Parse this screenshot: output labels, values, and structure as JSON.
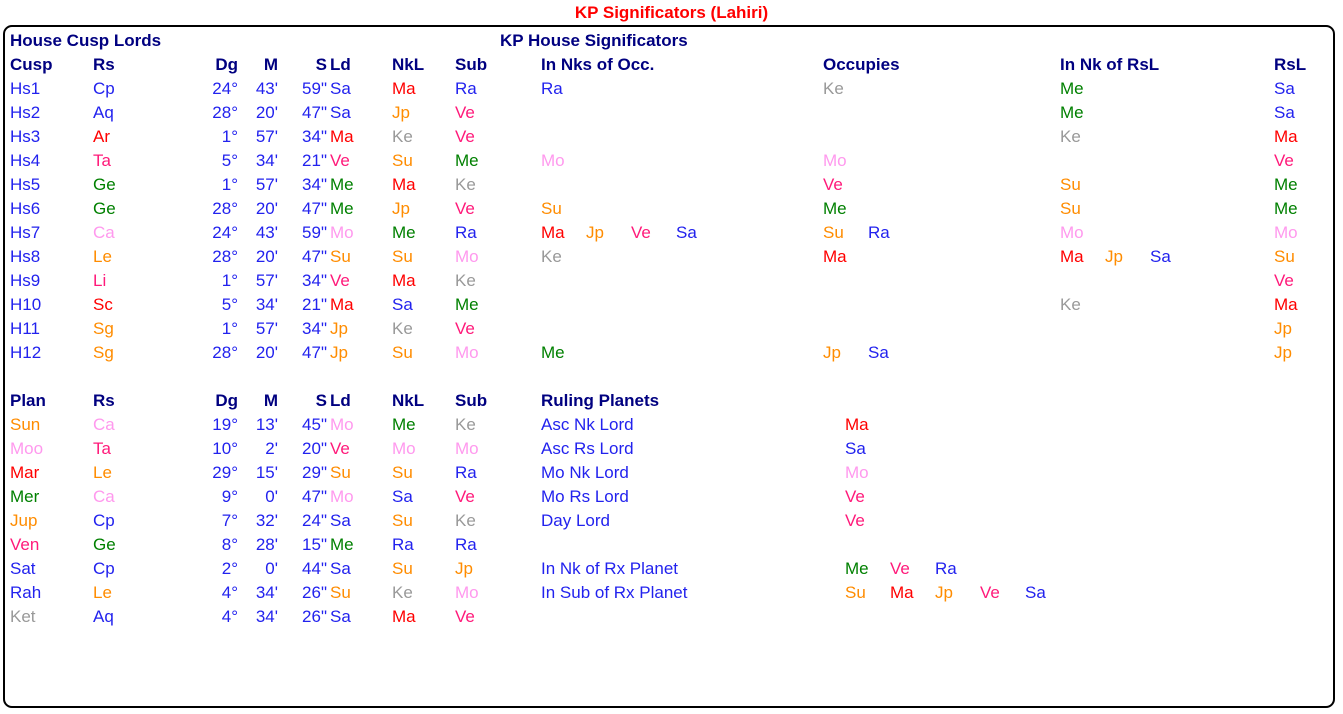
{
  "title": "KP Significators (Lahiri)",
  "sections": {
    "house_cusp_lords": "House Cusp Lords",
    "kp_house_significators": "KP House Significators",
    "ruling_planets": "Ruling Planets"
  },
  "cusp_headers": [
    "Cusp",
    "Rs",
    "Dg",
    "M",
    "S",
    "Ld",
    "NkL",
    "Sub"
  ],
  "sig_headers": [
    "In Nks of Occ.",
    "Occupies",
    "In Nk of RsL",
    "RsL"
  ],
  "plan_headers": [
    "Plan",
    "Rs",
    "Dg",
    "M",
    "S",
    "Ld",
    "NkL",
    "Sub"
  ],
  "colors": {
    "title": "#FF0000",
    "heading": "#000080",
    "number": "#2222EE",
    "Su": "#FF8C00",
    "Mo": "#FF99EE",
    "Ma": "#FF0000",
    "Me": "#008000",
    "Jp": "#FF8C00",
    "Ve": "#FF1A7A",
    "Sa": "#2222EE",
    "Ra": "#2222EE",
    "Ke": "#999999"
  },
  "cusp_rows": [
    {
      "cusp": "Hs1",
      "rs": "Cp",
      "rs_c": "sa",
      "dg": "24°",
      "m": "43'",
      "s": "59\"",
      "ld": "Sa",
      "ld_c": "sa",
      "nkl": "Ma",
      "nkl_c": "ma",
      "sub": "Ra",
      "sub_c": "ra",
      "nks_occ": [],
      "occupies": [
        {
          "t": "Ke",
          "c": "ke"
        }
      ],
      "nk_rsl": [
        {
          "t": "Me",
          "c": "me"
        }
      ],
      "rsl": "Sa",
      "rsl_c": "sa",
      "nks_occ_list": [
        {
          "t": "Ra",
          "c": "ra"
        }
      ]
    },
    {
      "cusp": "Hs2",
      "rs": "Aq",
      "rs_c": "sa",
      "dg": "28°",
      "m": "20'",
      "s": "47\"",
      "ld": "Sa",
      "ld_c": "sa",
      "nkl": "Jp",
      "nkl_c": "jp",
      "sub": "Ve",
      "sub_c": "ve",
      "nks_occ_list": [],
      "occupies": [],
      "nk_rsl": [
        {
          "t": "Me",
          "c": "me"
        }
      ],
      "rsl": "Sa",
      "rsl_c": "sa"
    },
    {
      "cusp": "Hs3",
      "rs": "Ar",
      "rs_c": "ma",
      "dg": "1°",
      "m": "57'",
      "s": "34\"",
      "ld": "Ma",
      "ld_c": "ma",
      "nkl": "Ke",
      "nkl_c": "ke",
      "sub": "Ve",
      "sub_c": "ve",
      "nks_occ_list": [],
      "occupies": [],
      "nk_rsl": [
        {
          "t": "Ke",
          "c": "ke"
        }
      ],
      "rsl": "Ma",
      "rsl_c": "ma"
    },
    {
      "cusp": "Hs4",
      "rs": "Ta",
      "rs_c": "ve",
      "dg": "5°",
      "m": "34'",
      "s": "21\"",
      "ld": "Ve",
      "ld_c": "ve",
      "nkl": "Su",
      "nkl_c": "su",
      "sub": "Me",
      "sub_c": "me",
      "nks_occ_list": [
        {
          "t": "Mo",
          "c": "mo"
        }
      ],
      "occupies": [
        {
          "t": "Mo",
          "c": "mo"
        }
      ],
      "nk_rsl": [],
      "rsl": "Ve",
      "rsl_c": "ve"
    },
    {
      "cusp": "Hs5",
      "rs": "Ge",
      "rs_c": "me",
      "dg": "1°",
      "m": "57'",
      "s": "34\"",
      "ld": "Me",
      "ld_c": "me",
      "nkl": "Ma",
      "nkl_c": "ma",
      "sub": "Ke",
      "sub_c": "ke",
      "nks_occ_list": [],
      "occupies": [
        {
          "t": "Ve",
          "c": "ve"
        }
      ],
      "nk_rsl": [
        {
          "t": "Su",
          "c": "su"
        }
      ],
      "rsl": "Me",
      "rsl_c": "me"
    },
    {
      "cusp": "Hs6",
      "rs": "Ge",
      "rs_c": "me",
      "dg": "28°",
      "m": "20'",
      "s": "47\"",
      "ld": "Me",
      "ld_c": "me",
      "nkl": "Jp",
      "nkl_c": "jp",
      "sub": "Ve",
      "sub_c": "ve",
      "nks_occ_list": [
        {
          "t": "Su",
          "c": "su"
        }
      ],
      "occupies": [
        {
          "t": "Me",
          "c": "me"
        }
      ],
      "nk_rsl": [
        {
          "t": "Su",
          "c": "su"
        }
      ],
      "rsl": "Me",
      "rsl_c": "me"
    },
    {
      "cusp": "Hs7",
      "rs": "Ca",
      "rs_c": "mo",
      "dg": "24°",
      "m": "43'",
      "s": "59\"",
      "ld": "Mo",
      "ld_c": "mo",
      "nkl": "Me",
      "nkl_c": "me",
      "sub": "Ra",
      "sub_c": "ra",
      "nks_occ_list": [
        {
          "t": "Ma",
          "c": "ma"
        },
        {
          "t": "Jp",
          "c": "jp"
        },
        {
          "t": "Ve",
          "c": "ve"
        },
        {
          "t": "Sa",
          "c": "sa"
        }
      ],
      "occupies": [
        {
          "t": "Su",
          "c": "su"
        },
        {
          "t": "Ra",
          "c": "ra"
        }
      ],
      "nk_rsl": [
        {
          "t": "Mo",
          "c": "mo"
        }
      ],
      "rsl": "Mo",
      "rsl_c": "mo"
    },
    {
      "cusp": "Hs8",
      "rs": "Le",
      "rs_c": "su",
      "dg": "28°",
      "m": "20'",
      "s": "47\"",
      "ld": "Su",
      "ld_c": "su",
      "nkl": "Su",
      "nkl_c": "su",
      "sub": "Mo",
      "sub_c": "mo",
      "nks_occ_list": [
        {
          "t": "Ke",
          "c": "ke"
        }
      ],
      "occupies": [
        {
          "t": "Ma",
          "c": "ma"
        }
      ],
      "nk_rsl": [
        {
          "t": "Ma",
          "c": "ma"
        },
        {
          "t": "Jp",
          "c": "jp"
        },
        {
          "t": "Sa",
          "c": "sa"
        }
      ],
      "rsl": "Su",
      "rsl_c": "su"
    },
    {
      "cusp": "Hs9",
      "rs": "Li",
      "rs_c": "ve",
      "dg": "1°",
      "m": "57'",
      "s": "34\"",
      "ld": "Ve",
      "ld_c": "ve",
      "nkl": "Ma",
      "nkl_c": "ma",
      "sub": "Ke",
      "sub_c": "ke",
      "nks_occ_list": [],
      "occupies": [],
      "nk_rsl": [],
      "rsl": "Ve",
      "rsl_c": "ve"
    },
    {
      "cusp": "H10",
      "rs": "Sc",
      "rs_c": "ma",
      "dg": "5°",
      "m": "34'",
      "s": "21\"",
      "ld": "Ma",
      "ld_c": "ma",
      "nkl": "Sa",
      "nkl_c": "sa",
      "sub": "Me",
      "sub_c": "me",
      "nks_occ_list": [],
      "occupies": [],
      "nk_rsl": [
        {
          "t": "Ke",
          "c": "ke"
        }
      ],
      "rsl": "Ma",
      "rsl_c": "ma"
    },
    {
      "cusp": "H11",
      "rs": "Sg",
      "rs_c": "jp",
      "dg": "1°",
      "m": "57'",
      "s": "34\"",
      "ld": "Jp",
      "ld_c": "jp",
      "nkl": "Ke",
      "nkl_c": "ke",
      "sub": "Ve",
      "sub_c": "ve",
      "nks_occ_list": [],
      "occupies": [],
      "nk_rsl": [],
      "rsl": "Jp",
      "rsl_c": "jp"
    },
    {
      "cusp": "H12",
      "rs": "Sg",
      "rs_c": "jp",
      "dg": "28°",
      "m": "20'",
      "s": "47\"",
      "ld": "Jp",
      "ld_c": "jp",
      "nkl": "Su",
      "nkl_c": "su",
      "sub": "Mo",
      "sub_c": "mo",
      "nks_occ_list": [
        {
          "t": "Me",
          "c": "me"
        }
      ],
      "occupies": [
        {
          "t": "Jp",
          "c": "jp"
        },
        {
          "t": "Sa",
          "c": "sa"
        }
      ],
      "nk_rsl": [],
      "rsl": "Jp",
      "rsl_c": "jp"
    }
  ],
  "plan_rows": [
    {
      "plan": "Sun",
      "plan_c": "su",
      "rs": "Ca",
      "rs_c": "mo",
      "dg": "19°",
      "m": "13'",
      "s": "45\"",
      "ld": "Mo",
      "ld_c": "mo",
      "nkl": "Me",
      "nkl_c": "me",
      "sub": "Ke",
      "sub_c": "ke"
    },
    {
      "plan": "Moo",
      "plan_c": "mo",
      "rs": "Ta",
      "rs_c": "ve",
      "dg": "10°",
      "m": "2'",
      "s": "20\"",
      "ld": "Ve",
      "ld_c": "ve",
      "nkl": "Mo",
      "nkl_c": "mo",
      "sub": "Mo",
      "sub_c": "mo"
    },
    {
      "plan": "Mar",
      "plan_c": "ma",
      "rs": "Le",
      "rs_c": "su",
      "dg": "29°",
      "m": "15'",
      "s": "29\"",
      "ld": "Su",
      "ld_c": "su",
      "nkl": "Su",
      "nkl_c": "su",
      "sub": "Ra",
      "sub_c": "ra"
    },
    {
      "plan": "Mer",
      "plan_c": "me",
      "rs": "Ca",
      "rs_c": "mo",
      "dg": "9°",
      "m": "0'",
      "s": "47\"",
      "ld": "Mo",
      "ld_c": "mo",
      "nkl": "Sa",
      "nkl_c": "sa",
      "sub": "Ve",
      "sub_c": "ve"
    },
    {
      "plan": "Jup",
      "plan_c": "jp",
      "rs": "Cp",
      "rs_c": "sa",
      "dg": "7°",
      "m": "32'",
      "s": "24\"",
      "ld": "Sa",
      "ld_c": "sa",
      "nkl": "Su",
      "nkl_c": "su",
      "sub": "Ke",
      "sub_c": "ke"
    },
    {
      "plan": "Ven",
      "plan_c": "ve",
      "rs": "Ge",
      "rs_c": "me",
      "dg": "8°",
      "m": "28'",
      "s": "15\"",
      "ld": "Me",
      "ld_c": "me",
      "nkl": "Ra",
      "nkl_c": "ra",
      "sub": "Ra",
      "sub_c": "ra"
    },
    {
      "plan": "Sat",
      "plan_c": "sa",
      "rs": "Cp",
      "rs_c": "sa",
      "dg": "2°",
      "m": "0'",
      "s": "44\"",
      "ld": "Sa",
      "ld_c": "sa",
      "nkl": "Su",
      "nkl_c": "su",
      "sub": "Jp",
      "sub_c": "jp"
    },
    {
      "plan": "Rah",
      "plan_c": "ra",
      "rs": "Le",
      "rs_c": "su",
      "dg": "4°",
      "m": "34'",
      "s": "26\"",
      "ld": "Su",
      "ld_c": "su",
      "nkl": "Ke",
      "nkl_c": "ke",
      "sub": "Mo",
      "sub_c": "mo"
    },
    {
      "plan": "Ket",
      "plan_c": "ke",
      "rs": "Aq",
      "rs_c": "sa",
      "dg": "4°",
      "m": "34'",
      "s": "26\"",
      "ld": "Sa",
      "ld_c": "sa",
      "nkl": "Ma",
      "nkl_c": "ma",
      "sub": "Ve",
      "sub_c": "ve"
    }
  ],
  "ruling_planets": [
    {
      "label": "Asc Nk Lord",
      "values": [
        {
          "t": "Ma",
          "c": "ma"
        }
      ]
    },
    {
      "label": "Asc Rs Lord",
      "values": [
        {
          "t": "Sa",
          "c": "sa"
        }
      ]
    },
    {
      "label": "Mo Nk Lord",
      "values": [
        {
          "t": "Mo",
          "c": "mo"
        }
      ]
    },
    {
      "label": "Mo Rs Lord",
      "values": [
        {
          "t": "Ve",
          "c": "ve"
        }
      ]
    },
    {
      "label": "Day Lord",
      "values": [
        {
          "t": "Ve",
          "c": "ve"
        }
      ]
    }
  ],
  "rx_rows": [
    {
      "label": "In Nk of Rx Planet",
      "values": [
        {
          "t": "Me",
          "c": "me"
        },
        {
          "t": "Ve",
          "c": "ve"
        },
        {
          "t": "Ra",
          "c": "ra"
        }
      ]
    },
    {
      "label": "In Sub of Rx Planet",
      "values": [
        {
          "t": "Su",
          "c": "su"
        },
        {
          "t": "Ma",
          "c": "ma"
        },
        {
          "t": "Jp",
          "c": "jp"
        },
        {
          "t": "Ve",
          "c": "ve"
        },
        {
          "t": "Sa",
          "c": "sa"
        }
      ]
    }
  ]
}
